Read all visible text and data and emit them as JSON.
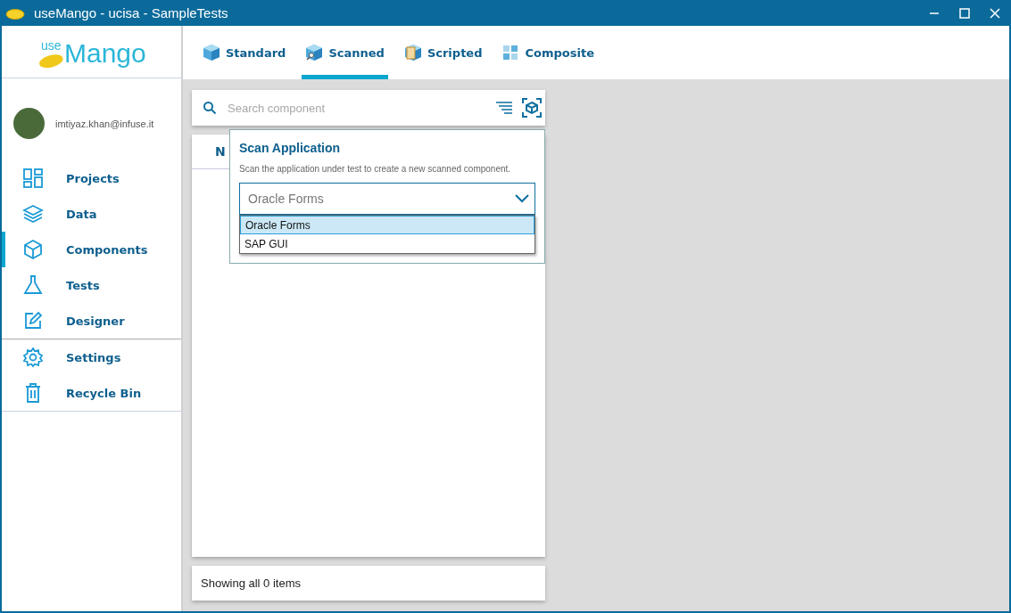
{
  "window": {
    "title": "useMango - ucisa - SampleTests"
  },
  "logo": {
    "prefix": "use",
    "name": "Mango"
  },
  "tabs": [
    {
      "label": "Standard",
      "kind": "standard",
      "selected": false
    },
    {
      "label": "Scanned",
      "kind": "scanned",
      "selected": true
    },
    {
      "label": "Scripted",
      "kind": "scripted",
      "selected": false
    },
    {
      "label": "Composite",
      "kind": "composite",
      "selected": false
    }
  ],
  "user": {
    "email": "imtiyaz.khan@infuse.it"
  },
  "sidebar": {
    "items": [
      {
        "label": "Projects",
        "kind": "projects",
        "selected": false
      },
      {
        "label": "Data",
        "kind": "data",
        "selected": false
      },
      {
        "label": "Components",
        "kind": "components",
        "selected": true
      },
      {
        "label": "Tests",
        "kind": "tests",
        "selected": false
      },
      {
        "label": "Designer",
        "kind": "designer",
        "selected": false
      }
    ],
    "bottom_items": [
      {
        "label": "Settings",
        "kind": "settings",
        "selected": false
      },
      {
        "label": "Recycle Bin",
        "kind": "bin",
        "selected": false
      }
    ]
  },
  "search": {
    "placeholder": "Search component"
  },
  "table": {
    "columns": [
      "N"
    ]
  },
  "scan_popup": {
    "title": "Scan Application",
    "description": "Scan the application under test to create a new scanned component.",
    "value": "Oracle Forms",
    "options": [
      {
        "label": "Oracle Forms",
        "selected": true
      },
      {
        "label": "SAP GUI",
        "selected": false
      }
    ]
  },
  "status": "Showing all 0 items"
}
